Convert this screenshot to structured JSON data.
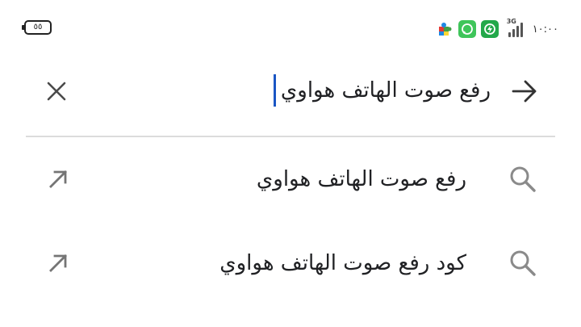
{
  "status_bar": {
    "battery_level": "٥٥",
    "network_type": "3G",
    "time": "١٠:٠٠",
    "notification_icons": [
      "puzzle-icon",
      "whatsapp-icon",
      "power-saver-icon"
    ]
  },
  "search": {
    "query": "رفع صوت الهاتف هواوي",
    "clear_icon": "close-icon",
    "submit_icon": "arrow-right-icon"
  },
  "suggestions": [
    {
      "text": "رفع صوت الهاتف هواوي",
      "icon": "search-icon",
      "action_icon": "arrow-up-left-icon"
    },
    {
      "text": "كود رفع صوت الهاتف هواوي",
      "icon": "search-icon",
      "action_icon": "arrow-up-left-icon"
    }
  ],
  "colors": {
    "caret": "#1a56c4",
    "divider": "#dcdcdc",
    "icon_gray": "#757575",
    "text": "#202124"
  }
}
